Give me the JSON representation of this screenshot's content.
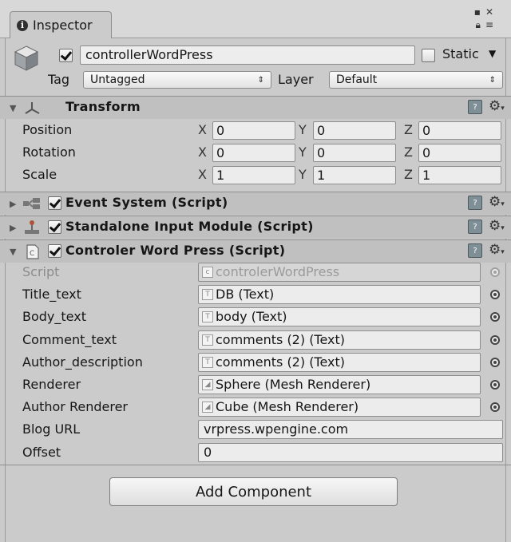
{
  "window": {
    "tab_title": "Inspector",
    "lock_icon": "lock-icon",
    "menu_icon": "menu-icon"
  },
  "gameobject": {
    "active": true,
    "name": "controllerWordPress",
    "static_label": "Static",
    "static_checked": false,
    "tag_label": "Tag",
    "tag_value": "Untagged",
    "layer_label": "Layer",
    "layer_value": "Default"
  },
  "transform": {
    "title": "Transform",
    "rows": [
      {
        "label": "Position",
        "x": "0",
        "y": "0",
        "z": "0"
      },
      {
        "label": "Rotation",
        "x": "0",
        "y": "0",
        "z": "0"
      },
      {
        "label": "Scale",
        "x": "1",
        "y": "1",
        "z": "1"
      }
    ],
    "axis_x": "X",
    "axis_y": "Y",
    "axis_z": "Z"
  },
  "components": [
    {
      "title": "Event System (Script)",
      "enabled": true,
      "expanded": false
    },
    {
      "title": "Standalone Input Module (Script)",
      "enabled": true,
      "expanded": false
    },
    {
      "title": "Controler Word Press (Script)",
      "enabled": true,
      "expanded": true
    }
  ],
  "script_fields": [
    {
      "label": "Script",
      "value": "controlerWordPress",
      "kind": "object",
      "disabled": true
    },
    {
      "label": "Title_text",
      "value": "DB (Text)",
      "kind": "object"
    },
    {
      "label": "Body_text",
      "value": "body (Text)",
      "kind": "object"
    },
    {
      "label": "Comment_text",
      "value": "comments (2) (Text)",
      "kind": "object"
    },
    {
      "label": "Author_description",
      "value": "comments (2) (Text)",
      "kind": "object"
    },
    {
      "label": "Renderer",
      "value": "Sphere (Mesh Renderer)",
      "kind": "object"
    },
    {
      "label": "Author Renderer",
      "value": "Cube (Mesh Renderer)",
      "kind": "object"
    },
    {
      "label": "Blog URL",
      "value": "vrpress.wpengine.com",
      "kind": "text"
    },
    {
      "label": "Offset",
      "value": "0",
      "kind": "text"
    }
  ],
  "add_component_label": "Add Component"
}
